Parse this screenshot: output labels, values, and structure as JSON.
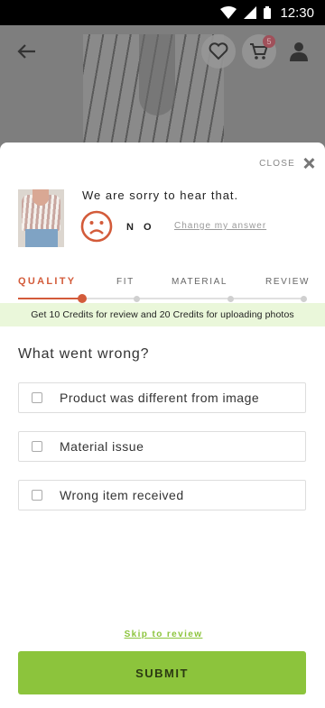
{
  "status_bar": {
    "time": "12:30"
  },
  "header": {
    "cart_count": "5"
  },
  "icons": {
    "back": "arrow-left-icon",
    "wishlist": "heart-icon",
    "cart": "cart-icon",
    "profile": "person-icon",
    "close": "close-icon",
    "mood": "sad-face-icon",
    "wifi": "wifi-icon",
    "signal": "signal-icon",
    "battery": "battery-icon"
  },
  "sheet": {
    "close_label": "CLOSE",
    "sorry_message": "We are sorry to hear that.",
    "answer": "N O",
    "change_answer": "Change my answer",
    "tabs": [
      {
        "label": "QUALITY",
        "active": true
      },
      {
        "label": "FIT",
        "active": false
      },
      {
        "label": "MATERIAL",
        "active": false
      },
      {
        "label": "REVIEW",
        "active": false
      }
    ],
    "credits_banner": "Get 10 Credits for review and 20 Credits for uploading photos",
    "question": "What went wrong?",
    "options": [
      {
        "label": "Product was different from image",
        "checked": false
      },
      {
        "label": "Material issue",
        "checked": false
      },
      {
        "label": "Wrong item received",
        "checked": false
      }
    ],
    "skip_link": "Skip to review",
    "submit_label": "SUBMIT"
  },
  "colors": {
    "accent": "#d35b3a",
    "primary_button": "#8cc43c",
    "banner_bg": "#eaf7da",
    "overlay": "#7e7e7e"
  }
}
